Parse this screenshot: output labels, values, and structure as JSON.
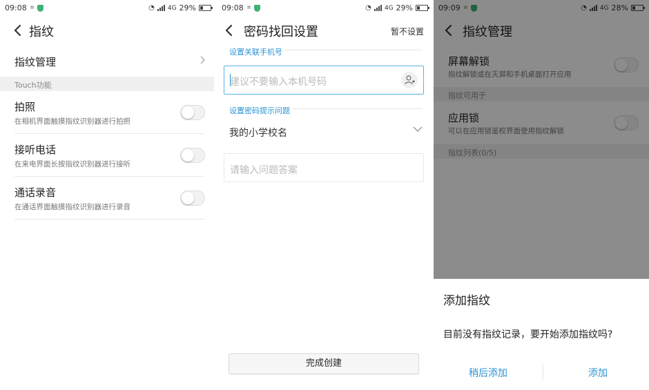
{
  "panel1": {
    "status": {
      "time": "09:08",
      "network": "4G",
      "battery": "29%",
      "battery_level": 0.29
    },
    "title": "指纹",
    "management_label": "指纹管理",
    "section_header": "Touch功能",
    "options": [
      {
        "title": "拍照",
        "subtitle": "在相机界面触摸指纹识别器进行拍照",
        "enabled": false
      },
      {
        "title": "接听电话",
        "subtitle": "在来电界面长按指纹识别器进行接听",
        "enabled": false
      },
      {
        "title": "通话录音",
        "subtitle": "在通话界面触摸指纹识别器进行录音",
        "enabled": false
      }
    ]
  },
  "panel2": {
    "status": {
      "time": "09:08",
      "network": "4G",
      "battery": "29%",
      "battery_level": 0.29
    },
    "title": "密码找回设置",
    "skip_label": "暂不设置",
    "phone_label": "设置关联手机号",
    "phone_placeholder": "建议不要输入本机号码",
    "question_label": "设置密码提示问题",
    "question_value": "我的小学校名",
    "answer_placeholder": "请输入问题答案",
    "finish_button": "完成创建"
  },
  "panel3": {
    "status": {
      "time": "09:09",
      "network": "4G",
      "battery": "28%",
      "battery_level": 0.28
    },
    "title": "指纹管理",
    "screen_unlock": {
      "title": "屏幕解锁",
      "subtitle": "指纹解锁或在灭屏和手机桌面打开应用",
      "enabled": false
    },
    "usage_header": "指纹可用于",
    "app_lock": {
      "title": "应用锁",
      "subtitle": "可以在应用锁鉴权界面使用指纹解锁",
      "enabled": false
    },
    "list_header": "指纹列表(0/5)",
    "dialog": {
      "title": "添加指纹",
      "message": "目前没有指纹记录，要开始添加指纹吗?",
      "later_button": "稍后添加",
      "add_button": "添加"
    }
  },
  "colors": {
    "accent": "#2a93d5",
    "section_bg": "#f0f0f0",
    "overlay": "rgba(0,0,0,0.45)"
  }
}
